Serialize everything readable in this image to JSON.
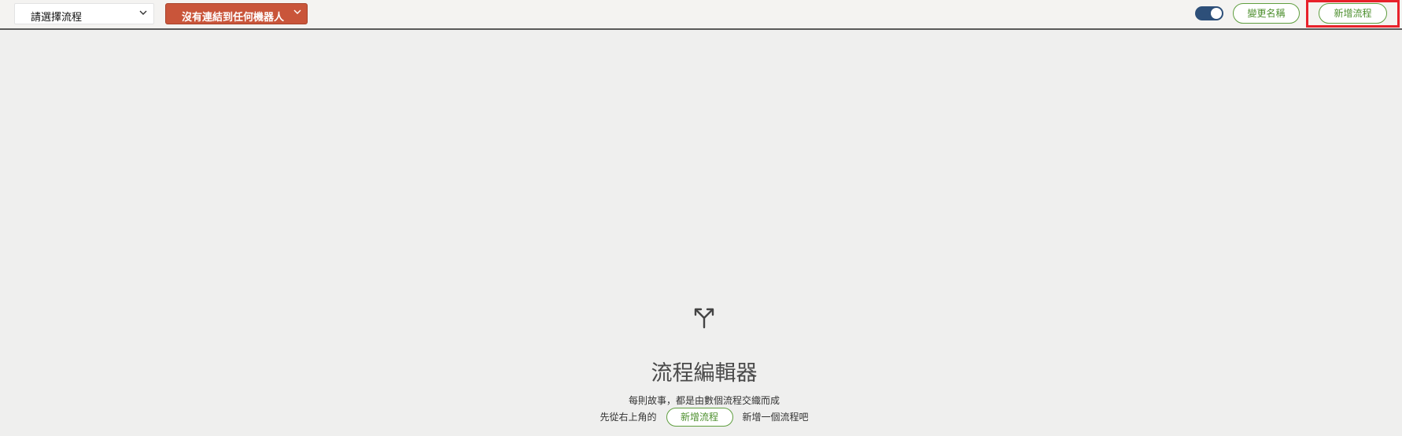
{
  "toolbar": {
    "flow_select": {
      "selected": "請選擇流程",
      "icon": "chevron-down-icon"
    },
    "robot_button": {
      "label": "沒有連結到任何機器人",
      "icon": "chevron-down-icon",
      "color": "#c9553a"
    },
    "toggle": {
      "state": "on",
      "color": "#2d4f79"
    },
    "rename_label": "變更名稱",
    "new_flow_label": "新增流程",
    "highlight_color": "#e8212b"
  },
  "empty_state": {
    "icon": "split-arrows-icon",
    "title": "流程編輯器",
    "description": "每則故事，都是由數個流程交織而成",
    "hint_prefix": "先從右上角的",
    "hint_button_label": "新增流程",
    "hint_suffix": "新增一個流程吧"
  },
  "colors": {
    "accent_green": "#4d8f2e",
    "background": "#efefee"
  }
}
